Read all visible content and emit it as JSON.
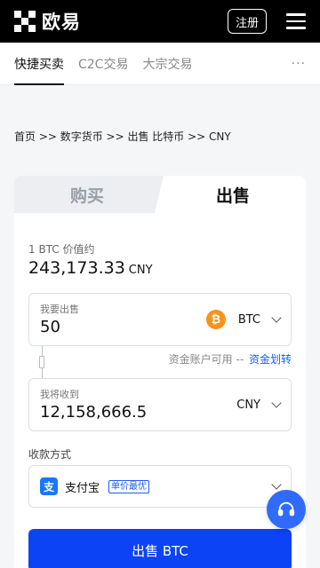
{
  "header": {
    "brand": "欧易",
    "register_label": "注册"
  },
  "subnav": {
    "tabs": [
      {
        "label": "快捷买卖",
        "active": true
      },
      {
        "label": "C2C交易",
        "active": false
      },
      {
        "label": "大宗交易",
        "active": false
      }
    ],
    "more_label": "···"
  },
  "breadcrumb": "首页 >> 数字货币 >> 出售 比特币 >> CNY",
  "trade": {
    "tabs": {
      "buy": "购买",
      "sell": "出售"
    },
    "active_tab": "sell",
    "price_label": "1 BTC 价值约",
    "price_value": "243,173.33",
    "price_currency": "CNY",
    "sell_field": {
      "label": "我要出售",
      "value": "50",
      "currency": "BTC"
    },
    "available_label": "资金账户可用 --",
    "transfer_label": "资金划转",
    "receive_field": {
      "label": "我将收到",
      "value": "12,158,666.5",
      "currency": "CNY"
    },
    "payment_label": "收款方式",
    "payment_method": {
      "name": "支付宝",
      "icon": "alipay-icon",
      "tag": "单价最优"
    },
    "submit_label": "出售 BTC"
  },
  "colors": {
    "accent": "#0b43f5",
    "link": "#1a5cff",
    "btc": "#f7931a",
    "alipay": "#1677ff",
    "header_bg": "#000000"
  }
}
